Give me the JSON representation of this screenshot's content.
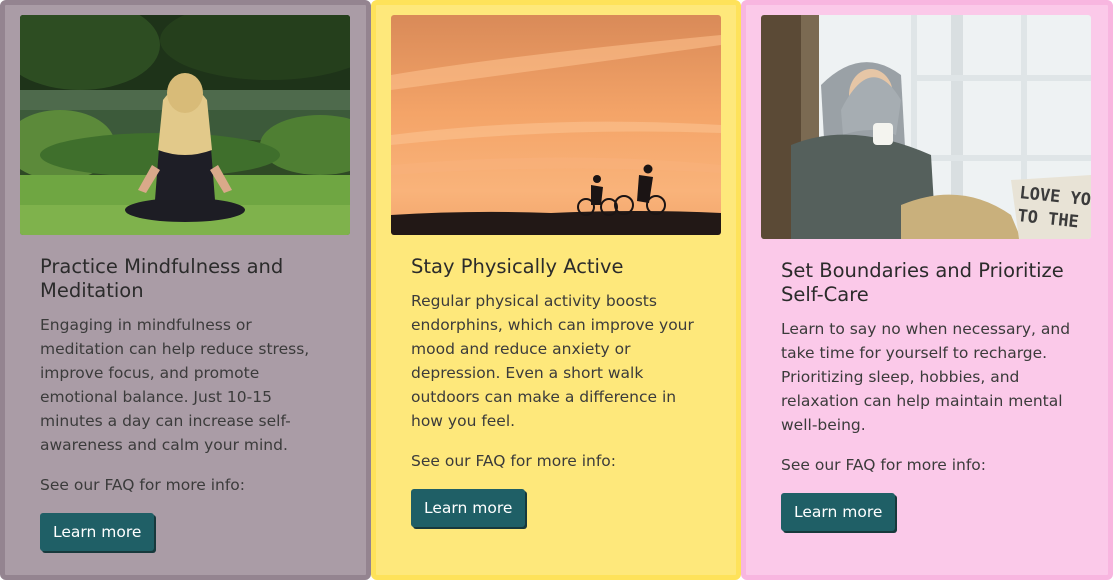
{
  "cards": [
    {
      "title": "Practice Mindfulness and Meditation",
      "description": "Engaging in mindfulness or meditation can help reduce stress, improve focus, and promote emotional balance. Just 10-15 minutes a day can increase self-awareness and calm your mind.",
      "faq": "See our FAQ for more info:",
      "button": "Learn more",
      "image": "woman-meditating-in-park",
      "background": "#aa9ca6"
    },
    {
      "title": "Stay Physically Active",
      "description": "Regular physical activity boosts endorphins, which can improve your mood and reduce anxiety or depression. Even a short walk outdoors can make a difference in how you feel.",
      "faq": "See our FAQ for more info:",
      "button": "Learn more",
      "image": "cyclists-at-sunset",
      "background": "#fee87b"
    },
    {
      "title": "Set Boundaries and Prioritize Self-Care",
      "description": "Learn to say no when necessary, and take time for yourself to recharge. Prioritizing sleep, hobbies, and relaxation can help maintain mental well-being.",
      "faq": "See our FAQ for more info:",
      "button": "Learn more",
      "image": "woman-with-tea-by-window",
      "pillow_text": "LOVE YOU TO THE",
      "background": "#fbc9e9"
    }
  ],
  "colors": {
    "button": "#1f5f66",
    "button_text": "#ffffff"
  }
}
